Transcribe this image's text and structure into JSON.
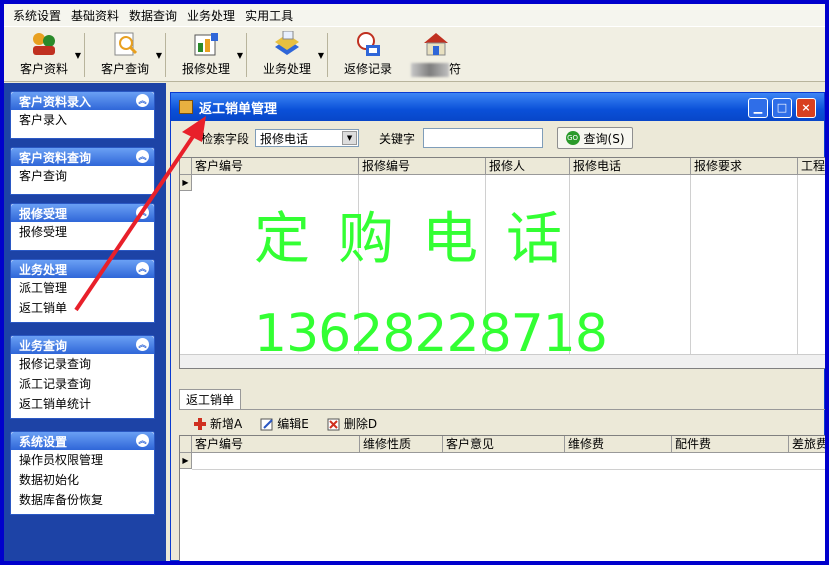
{
  "menu": [
    "系统设置",
    "基础资料",
    "数据查询",
    "业务处理",
    "实用工具"
  ],
  "toolbar": {
    "items": [
      {
        "label": "客户资料",
        "icon": "people-icon"
      },
      {
        "label": "客户查询",
        "icon": "search-doc-icon"
      },
      {
        "label": "报修处理",
        "icon": "repair-icon"
      },
      {
        "label": "业务处理",
        "icon": "business-icon"
      },
      {
        "label": "返修记录",
        "icon": "record-icon"
      }
    ],
    "last_suffix": "符"
  },
  "sidebar": [
    {
      "title": "客户资料录入",
      "items": [
        "客户录入"
      ]
    },
    {
      "title": "客户资料查询",
      "items": [
        "客户查询"
      ]
    },
    {
      "title": "报修受理",
      "items": [
        "报修受理"
      ]
    },
    {
      "title": "业务处理",
      "items": [
        "派工管理",
        "返工销单"
      ]
    },
    {
      "title": "业务查询",
      "items": [
        "报修记录查询",
        "派工记录查询",
        "返工销单统计"
      ]
    },
    {
      "title": "系统设置",
      "items": [
        "操作员权限管理",
        "数据初始化",
        "数据库备份恢复"
      ]
    }
  ],
  "window": {
    "title": "返工销单管理",
    "filter": {
      "field_label": "检索字段",
      "field_value": "报修电话",
      "keyword_label": "关键字",
      "keyword_value": "",
      "query_button": "查询(S)"
    },
    "grid1_headers": [
      "客户编号",
      "报修编号",
      "报修人",
      "报修电话",
      "报修要求",
      "工程师"
    ],
    "tab": "返工销单",
    "actions": [
      "新增A",
      "编辑E",
      "删除D"
    ],
    "grid2_headers": [
      "客户编号",
      "维修性质",
      "客户意见",
      "维修费",
      "配件费",
      "差旅费"
    ]
  },
  "watermark": {
    "line1": "定购电话",
    "line2": "13628228718"
  },
  "colors": {
    "accent": "#0a50d8",
    "watermark": "#33ff33",
    "arrow": "#e8202a",
    "sidebar": "#1d43a6"
  }
}
